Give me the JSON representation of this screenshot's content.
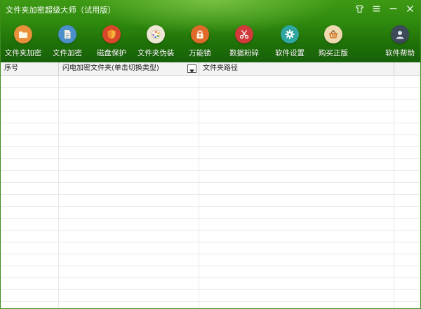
{
  "window": {
    "title": "文件夹加密超级大师（试用版）"
  },
  "titlebar_controls": [
    {
      "name": "skin",
      "icon": "shirt-icon"
    },
    {
      "name": "menu",
      "icon": "menu-icon"
    },
    {
      "name": "minimize",
      "icon": "minimize-icon"
    },
    {
      "name": "close",
      "icon": "close-icon"
    }
  ],
  "toolbar": {
    "items": [
      {
        "label": "文件夹加密",
        "icon": "folder-icon",
        "color": "#e8903a"
      },
      {
        "label": "文件加密",
        "icon": "file-icon",
        "color": "#4a8fc8"
      },
      {
        "label": "磁盘保护",
        "icon": "shield-icon",
        "color": "#d9472b"
      },
      {
        "label": "文件夹伪装",
        "icon": "palette-icon",
        "color": "#efe7d6"
      },
      {
        "label": "万能锁",
        "icon": "lock-icon",
        "color": "#e06a2a"
      },
      {
        "label": "数据粉碎",
        "icon": "scissors-icon",
        "color": "#d03a3a"
      },
      {
        "label": "软件设置",
        "icon": "gear-icon",
        "color": "#2fa6a0"
      },
      {
        "label": "购买正版",
        "icon": "basket-icon",
        "color": "#eed9b0"
      },
      {
        "label": "软件帮助",
        "icon": "user-icon",
        "color": "#3d4a5a"
      }
    ]
  },
  "table": {
    "columns": [
      {
        "label": "序号"
      },
      {
        "label": "闪电加密文件夹(单击切换类型)"
      },
      {
        "label": "文件夹路径"
      },
      {
        "label": ""
      }
    ],
    "rows": []
  }
}
